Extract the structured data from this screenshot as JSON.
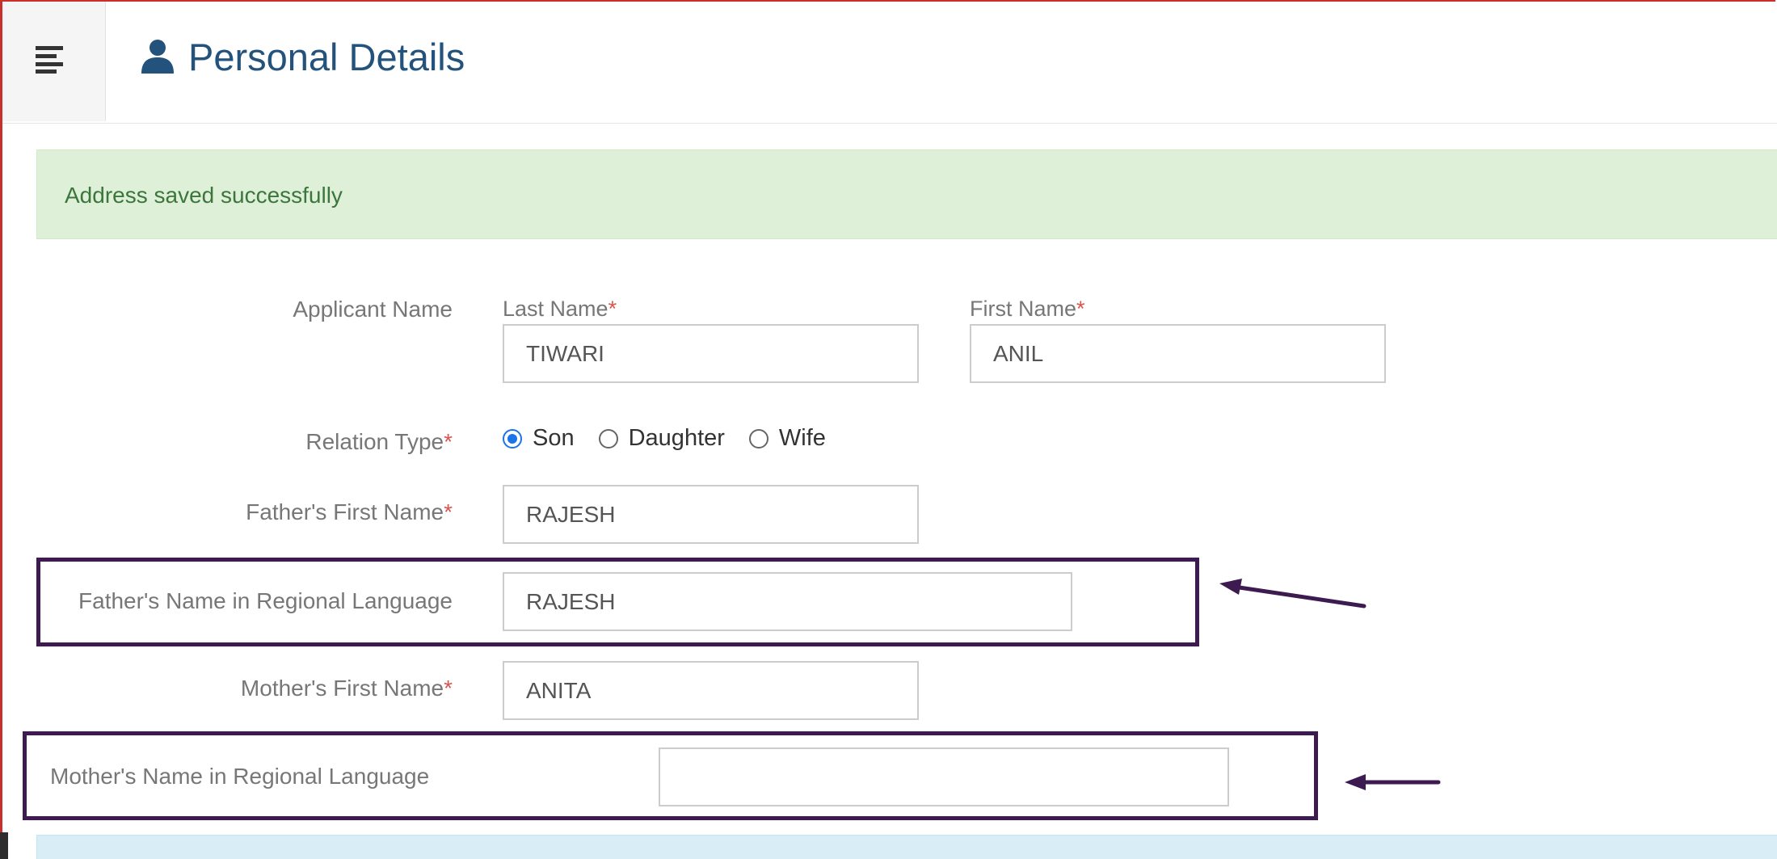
{
  "header": {
    "title": "Personal Details",
    "menu_icon": "hamburger-menu-icon",
    "title_icon": "user-icon"
  },
  "alert": {
    "message": "Address saved successfully"
  },
  "form": {
    "applicant_name_label": "Applicant Name",
    "last_name_label": "Last Name",
    "last_name_value": "TIWARI",
    "first_name_label": "First Name",
    "first_name_value": "ANIL",
    "required_mark": "*",
    "relation_type_label": "Relation Type",
    "relation_options": [
      "Son",
      "Daughter",
      "Wife"
    ],
    "relation_selected": "Son",
    "father_first_name_label": "Father's First Name",
    "father_first_name_value": "RAJESH",
    "father_regional_label": "Father's Name in Regional Language",
    "father_regional_value": "RAJESH",
    "mother_first_name_label": "Mother's First Name",
    "mother_first_name_value": "ANITA",
    "mother_regional_label": "Mother's Name in Regional Language",
    "mother_regional_value": ""
  },
  "colors": {
    "title": "#23527c",
    "success_bg": "#dff0d8",
    "success_text": "#3c763d",
    "annotation": "#3d1a4f",
    "required": "#d9534f",
    "frame_border": "#c9302c",
    "info_bg": "#d9edf7"
  }
}
